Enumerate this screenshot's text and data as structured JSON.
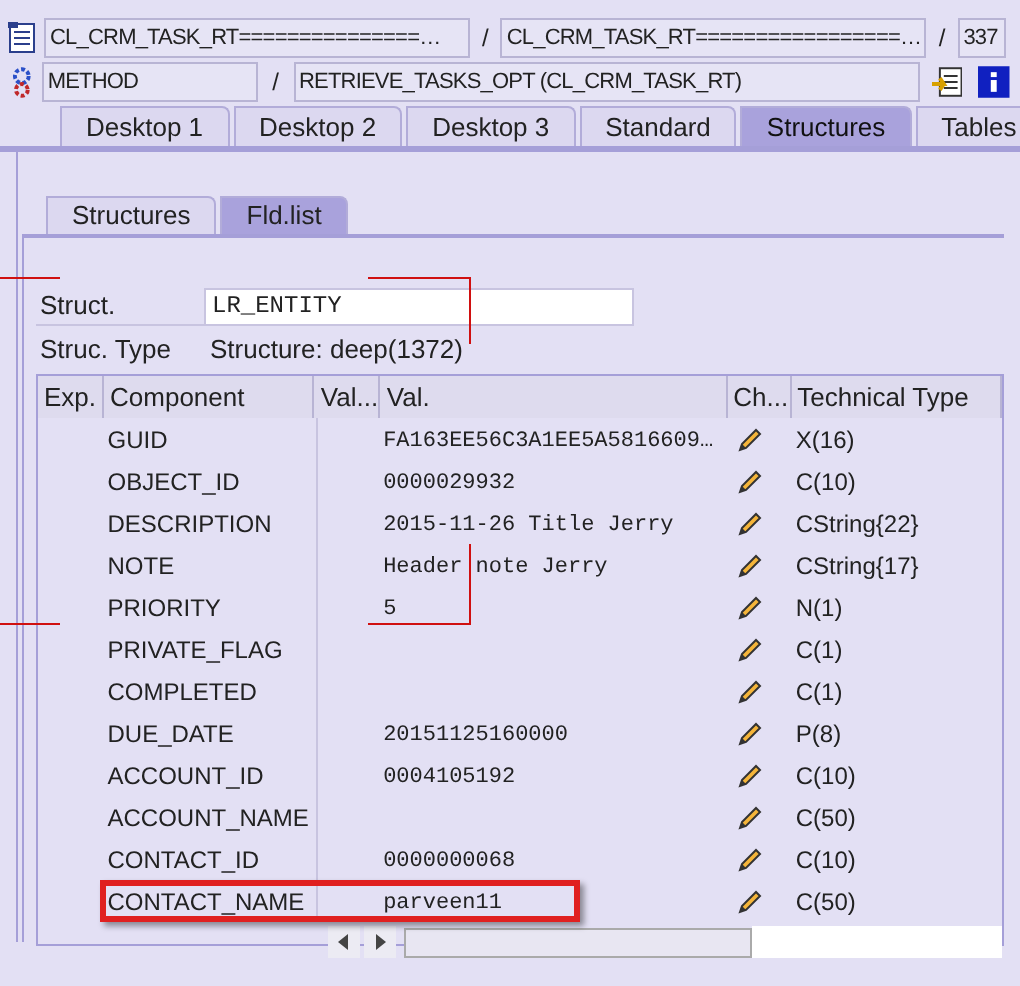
{
  "header": {
    "class_field": "CL_CRM_TASK_RT===============…",
    "separator_1": "/",
    "include_field": "CL_CRM_TASK_RT=================…",
    "separator_2": "/",
    "line_field": "337",
    "type_field": "METHOD",
    "separator_3": "/",
    "method_field": "RETRIEVE_TASKS_OPT (CL_CRM_TASK_RT)"
  },
  "tabs": [
    {
      "label": "Desktop 1",
      "selected": false
    },
    {
      "label": "Desktop 2",
      "selected": false
    },
    {
      "label": "Desktop 3",
      "selected": false
    },
    {
      "label": "Standard",
      "selected": false
    },
    {
      "label": "Structures",
      "selected": true
    },
    {
      "label": "Tables",
      "selected": false
    }
  ],
  "subtabs": [
    {
      "label": "Structures",
      "selected": false
    },
    {
      "label": "Fld.list",
      "selected": true
    }
  ],
  "struct": {
    "label": "Struct.",
    "value": "LR_ENTITY"
  },
  "struct_type": {
    "label": "Struc. Type",
    "value": "Structure: deep(1372)"
  },
  "table": {
    "columns": [
      "Exp.",
      "Component",
      "Val...",
      "Val.",
      "Ch...",
      "Technical Type"
    ],
    "rows": [
      {
        "component": "GUID",
        "value": "FA163EE56C3A1EE5A5816609…",
        "type": "X(16)",
        "highlighted": false
      },
      {
        "component": "OBJECT_ID",
        "value": "0000029932",
        "type": "C(10)",
        "highlighted": false
      },
      {
        "component": "DESCRIPTION",
        "value": "2015-11-26 Title Jerry",
        "type": "CString{22}",
        "highlighted": false
      },
      {
        "component": "NOTE",
        "value": "Header note Jerry",
        "type": "CString{17}",
        "highlighted": false
      },
      {
        "component": "PRIORITY",
        "value": "5",
        "type": "N(1)",
        "highlighted": false
      },
      {
        "component": "PRIVATE_FLAG",
        "type": "C(1)",
        "highlighted": false
      },
      {
        "component": "COMPLETED",
        "type": "C(1)",
        "highlighted": false
      },
      {
        "component": "DUE_DATE",
        "value": "20151125160000",
        "type": "P(8)",
        "highlighted": false
      },
      {
        "component": "ACCOUNT_ID",
        "value": "0004105192",
        "type": "C(10)",
        "highlighted": false
      },
      {
        "component": "ACCOUNT_NAME",
        "type": "C(50)",
        "highlighted": false
      },
      {
        "component": "CONTACT_ID",
        "value": "0000000068",
        "type": "C(10)",
        "highlighted": false
      },
      {
        "component": "CONTACT_NAME",
        "value": "parveen11",
        "type": "C(50)",
        "highlighted": true
      }
    ]
  }
}
